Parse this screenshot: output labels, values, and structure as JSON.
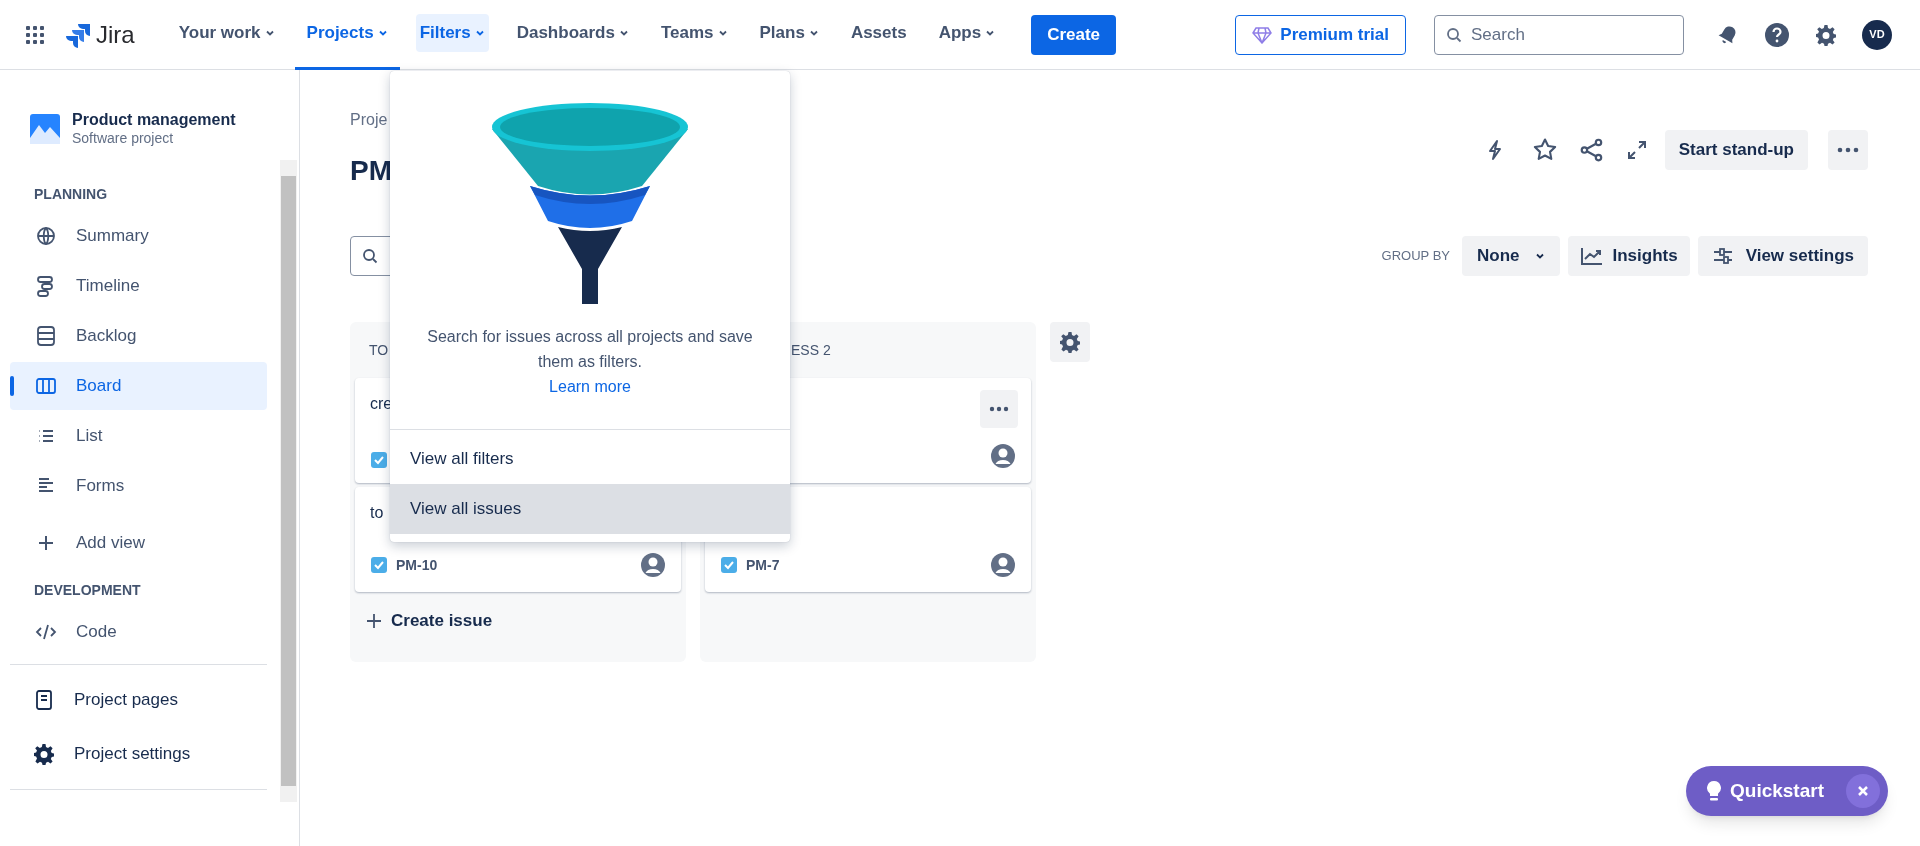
{
  "top_nav": {
    "product": "Jira",
    "items": [
      {
        "label": "Your work",
        "menu": true,
        "selected": false,
        "open": false
      },
      {
        "label": "Projects",
        "menu": true,
        "selected": true,
        "open": false
      },
      {
        "label": "Filters",
        "menu": true,
        "selected": false,
        "open": true
      },
      {
        "label": "Dashboards",
        "menu": true,
        "selected": false,
        "open": false
      },
      {
        "label": "Teams",
        "menu": true,
        "selected": false,
        "open": false
      },
      {
        "label": "Plans",
        "menu": true,
        "selected": false,
        "open": false
      },
      {
        "label": "Assets",
        "menu": false,
        "selected": false,
        "open": false
      },
      {
        "label": "Apps",
        "menu": true,
        "selected": false,
        "open": false
      }
    ],
    "create_button": "Create",
    "premium_button": "Premium trial",
    "search": {
      "placeholder": "Search"
    },
    "avatar": "VD"
  },
  "sidebar": {
    "project": {
      "name": "Product management",
      "type": "Software project"
    },
    "sections": [
      {
        "heading": "PLANNING",
        "items": [
          {
            "label": "Summary",
            "kind": "globe",
            "selected": false
          },
          {
            "label": "Timeline",
            "kind": "timeline",
            "selected": false
          },
          {
            "label": "Backlog",
            "kind": "backlog",
            "selected": false
          },
          {
            "label": "Board",
            "kind": "board",
            "selected": true
          },
          {
            "label": "List",
            "kind": "list",
            "selected": false
          },
          {
            "label": "Forms",
            "kind": "forms",
            "selected": false
          }
        ],
        "add_item": "Add view"
      },
      {
        "heading": "DEVELOPMENT",
        "items": [
          {
            "label": "Code",
            "kind": "code",
            "selected": false
          }
        ]
      }
    ],
    "footer_items": [
      {
        "label": "Project pages",
        "kind": "page"
      },
      {
        "label": "Project settings",
        "kind": "gear"
      }
    ]
  },
  "board": {
    "breadcrumb": "Proje",
    "title": "PM",
    "actions": {
      "standup_button": "Start stand-up"
    },
    "group_by": {
      "label": "GROUP BY",
      "value": "None"
    },
    "insights_button": "Insights",
    "view_settings_button": "View settings",
    "columns": [
      {
        "header": "TO",
        "cards": [
          {
            "title": "cre"
          },
          {
            "title": "to",
            "key": "PM-10"
          }
        ],
        "create_issue": "Create issue"
      },
      {
        "header": "ESS 2",
        "cards": [
          {
            "menu": true
          },
          {
            "key": "PM-7",
            "menu": false
          }
        ]
      }
    ]
  },
  "filters_menu": {
    "description": "Search for issues across all projects and save them as filters.",
    "link": "Learn more",
    "items": [
      {
        "label": "View all filters",
        "hovered": false
      },
      {
        "label": "View all issues",
        "hovered": true
      }
    ]
  },
  "quickstart": {
    "label": "Quickstart"
  }
}
